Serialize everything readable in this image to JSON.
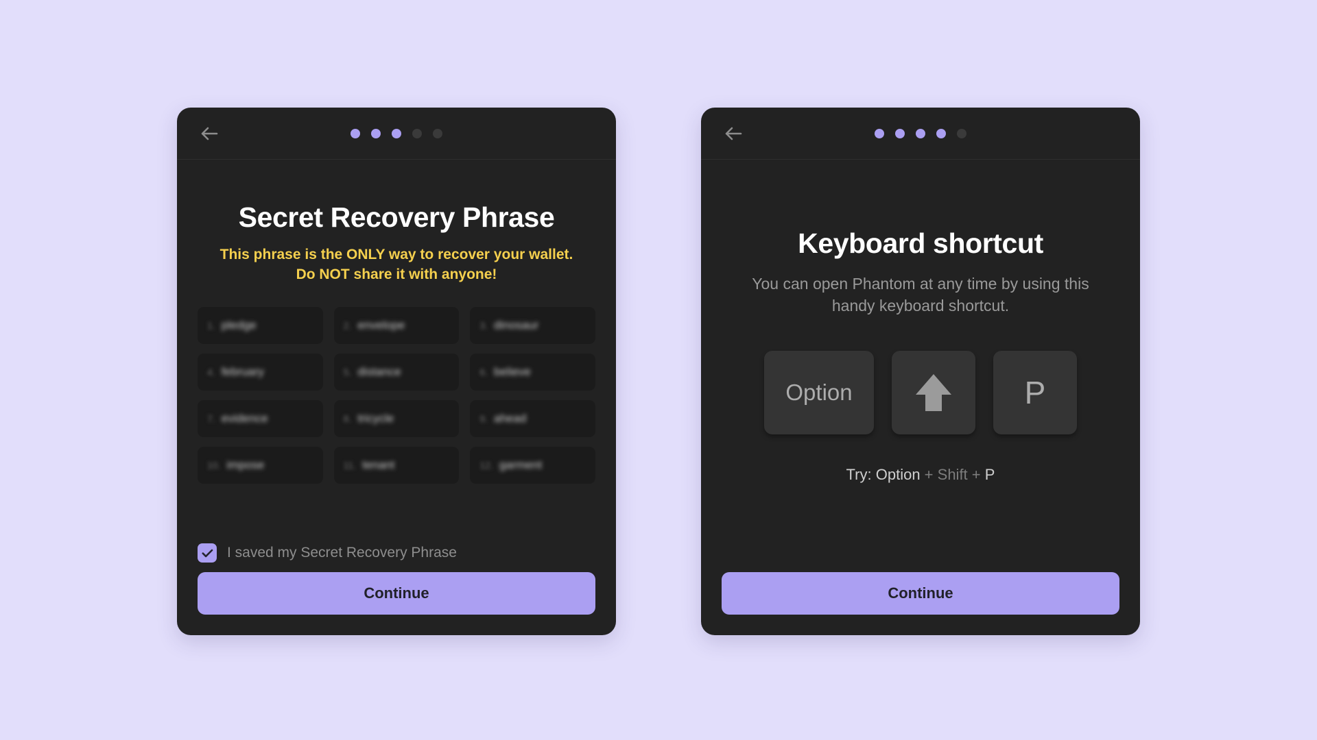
{
  "theme": {
    "page_background": "#E2DEFB",
    "card_background": "#222222",
    "accent": "#AB9FF2",
    "warning_color": "#F5D04E",
    "muted_text": "#9A9A9A",
    "keycap_background": "#343434"
  },
  "left_card": {
    "name": "secret-recovery-phrase-screen",
    "header": {
      "back_icon": "arrow-left-icon",
      "dots_total": 5,
      "dots_active": 3
    },
    "title": "Secret Recovery Phrase",
    "warning": "This phrase is the ONLY way to recover your wallet. Do NOT share it with anyone!",
    "seed_words": [
      {
        "index": "1.",
        "word": "pledge"
      },
      {
        "index": "2.",
        "word": "envelope"
      },
      {
        "index": "3.",
        "word": "dinosaur"
      },
      {
        "index": "4.",
        "word": "february"
      },
      {
        "index": "5.",
        "word": "distance"
      },
      {
        "index": "6.",
        "word": "believe"
      },
      {
        "index": "7.",
        "word": "evidence"
      },
      {
        "index": "8.",
        "word": "tricycle"
      },
      {
        "index": "9.",
        "word": "ahead"
      },
      {
        "index": "10.",
        "word": "impose"
      },
      {
        "index": "11.",
        "word": "tenant"
      },
      {
        "index": "12.",
        "word": "garment"
      }
    ],
    "checkbox": {
      "label": "I saved my Secret Recovery Phrase",
      "checked": true,
      "icon": "check-icon"
    },
    "continue_label": "Continue"
  },
  "right_card": {
    "name": "keyboard-shortcut-screen",
    "header": {
      "back_icon": "arrow-left-icon",
      "dots_total": 5,
      "dots_active": 4
    },
    "title": "Keyboard shortcut",
    "subtitle": "You can open Phantom at any time by using this handy keyboard shortcut.",
    "keycaps": [
      {
        "label": "Option",
        "icon": null,
        "shape": "wide"
      },
      {
        "label": "",
        "icon": "shift-arrow-up-icon",
        "shape": "square"
      },
      {
        "label": "P",
        "icon": null,
        "shape": "square"
      }
    ],
    "hint": {
      "prefix": "Try: ",
      "key1": "Option",
      "sep1": " + ",
      "key2": "Shift",
      "sep2": " + ",
      "key3": "P"
    },
    "continue_label": "Continue"
  }
}
